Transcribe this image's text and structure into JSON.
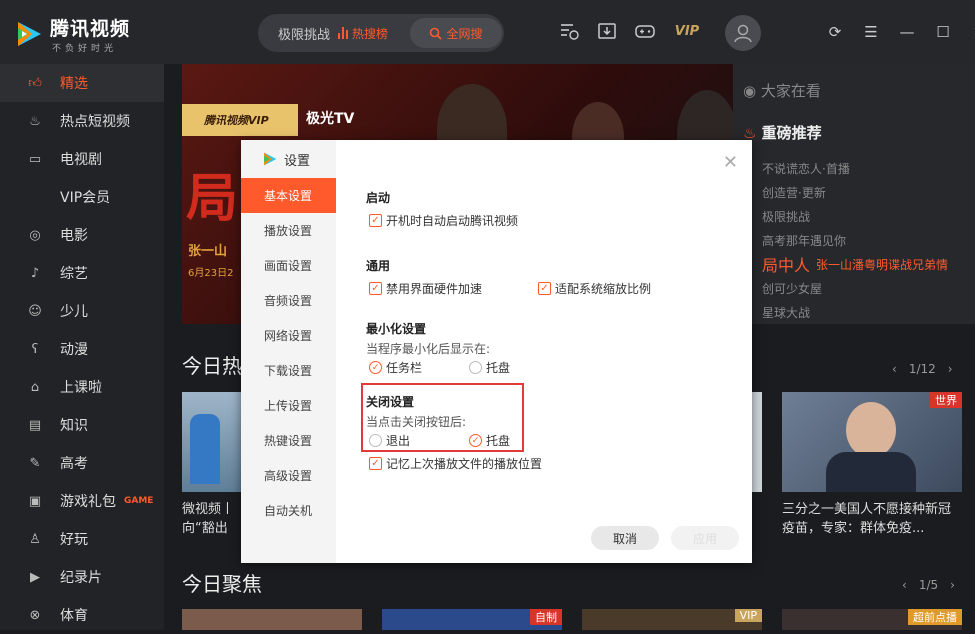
{
  "app": {
    "title": "腾讯视频",
    "slogan": "不负好时光"
  },
  "search": {
    "query": "极限挑战",
    "hot_label": "热搜榜",
    "button_label": "全网搜"
  },
  "topbar": {
    "vip_label": "VIP"
  },
  "sidebar": {
    "items": [
      {
        "label": "精选",
        "icon": "thumbs-up-icon",
        "active": true
      },
      {
        "label": "热点短视频",
        "icon": "flame-icon"
      },
      {
        "label": "电视剧",
        "icon": "tv-icon"
      },
      {
        "label": "VIP会员",
        "icon": ""
      },
      {
        "label": "电影",
        "icon": "film-reel-icon"
      },
      {
        "label": "综艺",
        "icon": "microphone-icon"
      },
      {
        "label": "少儿",
        "icon": "kid-icon"
      },
      {
        "label": "动漫",
        "icon": "bear-icon"
      },
      {
        "label": "上课啦",
        "icon": "graduation-cap-icon"
      },
      {
        "label": "知识",
        "icon": "book-icon"
      },
      {
        "label": "高考",
        "icon": "exam-icon"
      },
      {
        "label": "游戏礼包",
        "icon": "gamepad-icon",
        "badge": "GAME"
      },
      {
        "label": "好玩",
        "icon": "joystick-icon"
      },
      {
        "label": "纪录片",
        "icon": "camera-icon"
      },
      {
        "label": "体育",
        "icon": "ball-icon"
      }
    ]
  },
  "banner": {
    "brand": "腾讯视频VIP",
    "brand2": "极光TV",
    "big_char": "局",
    "name": "张一山",
    "date": "6月23日2"
  },
  "right_panel": {
    "title": "大家在看",
    "hot_title": "重磅推荐",
    "items": [
      {
        "text": "不说谎恋人·首播"
      },
      {
        "text": "创造营·更新"
      },
      {
        "text": "极限挑战"
      },
      {
        "text": "高考那年遇见你"
      },
      {
        "text": "局中人",
        "sub": "张一山潘粤明谍战兄弟情",
        "highlight": true
      },
      {
        "text": "创可少女屋"
      },
      {
        "text": "星球大战"
      }
    ]
  },
  "sections": {
    "hot": {
      "title": "今日热",
      "pager": "1/12"
    },
    "focus": {
      "title": "今日聚焦",
      "pager": "1/5"
    }
  },
  "cards": {
    "left_caption_1": "微视频丨",
    "left_caption_2": "向“豁出",
    "right_caption": "三分之一美国人不愿接种新冠疫苗，专家：群体免疫...",
    "right_tag": "世界",
    "focus_tags": [
      "自制",
      "VIP",
      "超前点播"
    ]
  },
  "dialog": {
    "title": "设置",
    "nav": [
      "基本设置",
      "播放设置",
      "画面设置",
      "音频设置",
      "网络设置",
      "下载设置",
      "上传设置",
      "热键设置",
      "高级设置",
      "自动关机"
    ],
    "active_nav": 0,
    "groups": {
      "startup": {
        "title": "启动",
        "option": "开机时自动启动腾讯视频",
        "checked": true
      },
      "general": {
        "title": "通用",
        "option1": "禁用界面硬件加速",
        "option2": "适配系统缩放比例",
        "checked1": true,
        "checked2": true
      },
      "minimize": {
        "title": "最小化设置",
        "sub": "当程序最小化后显示在:",
        "option1": "任务栏",
        "option2": "托盘",
        "selected": "任务栏"
      },
      "close": {
        "title": "关闭设置",
        "sub": "当点击关闭按钮后:",
        "option1": "退出",
        "option2": "托盘",
        "selected": "托盘"
      },
      "remember": {
        "option": "记忆上次播放文件的播放位置",
        "checked": true
      }
    },
    "buttons": {
      "cancel": "取消",
      "apply": "应用"
    }
  },
  "colors": {
    "accent": "#ff5a2c",
    "highlight_box": "#e03a3a"
  }
}
